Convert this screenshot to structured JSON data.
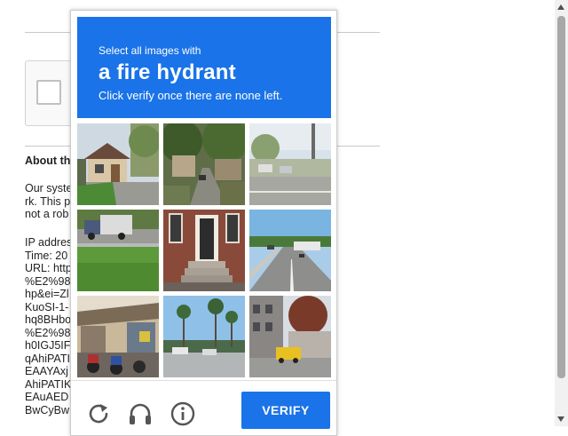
{
  "background": {
    "about_heading": "About th",
    "paragraph": "Our syste                                                        er netwo\nrk. This p                                                         ests, and\nnot a rob",
    "details": "IP addres\nTime: 20\nURL: http                                                        rs+Talk\n%E2%98                                                          ource=\nhp&ei=Zl                                                         AaF1Dd\nKuoSI-1-                                                          OAxWT\nhq8BHbo                                                         rs+Talk\n%E2%98                                                          d3JpZ2\nh0IGJ5IF                                                         AAYAxj\nqAhiPATI                                                         hiPATIK\nEAAYAxj                                                          AYAxjq\nAhiPATIK                                                         AEAqg\nEAuAED                                                           IHATGg\nBwCyBw                                                          daLnnN"
  },
  "captcha": {
    "instruction_small": "Select all images with",
    "target": "a fire hydrant",
    "instruction_sub": "Click verify once there are none left.",
    "verify_label": "VERIFY",
    "accent_color": "#1a73e8",
    "tiles": [
      "house-driveway",
      "narrow-street-trees",
      "road-parking-lot",
      "truck-highway-grass",
      "brick-building-stoop",
      "highway-cars",
      "street-market-motorbikes",
      "palm-trees-parking",
      "building-yellow-taxi"
    ],
    "footer_icons": [
      "reload-icon",
      "audio-challenge-icon",
      "info-icon"
    ]
  }
}
